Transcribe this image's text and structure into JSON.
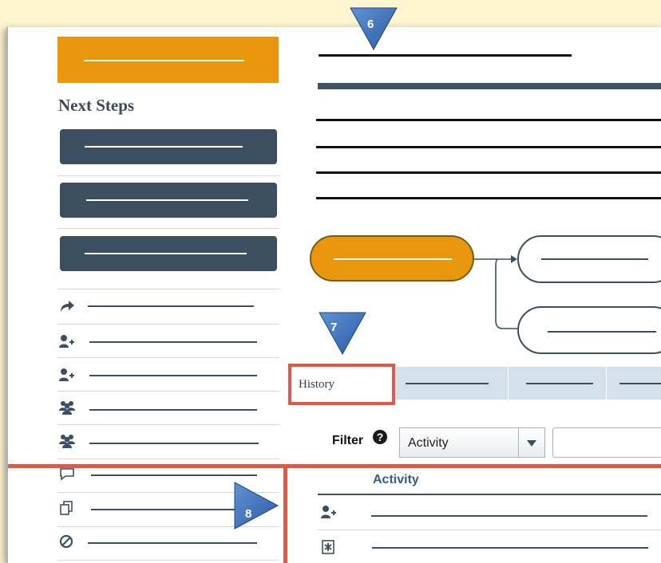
{
  "sidebar": {
    "title": "Next Steps"
  },
  "tabs": {
    "history": "History"
  },
  "filter": {
    "label": "Filter",
    "help_icon": "question-circle-icon",
    "selected": "Activity"
  },
  "table": {
    "column_header": "Activity"
  },
  "callouts": [
    "6",
    "7",
    "8"
  ],
  "colors": {
    "accent_orange": "#e8960c",
    "navy": "#3c4f61",
    "callout_blue": "#3e73b9",
    "highlight_red": "#dd5a48",
    "tab_bg": "#d5e1ea",
    "link_blue": "#2f5f8a"
  }
}
